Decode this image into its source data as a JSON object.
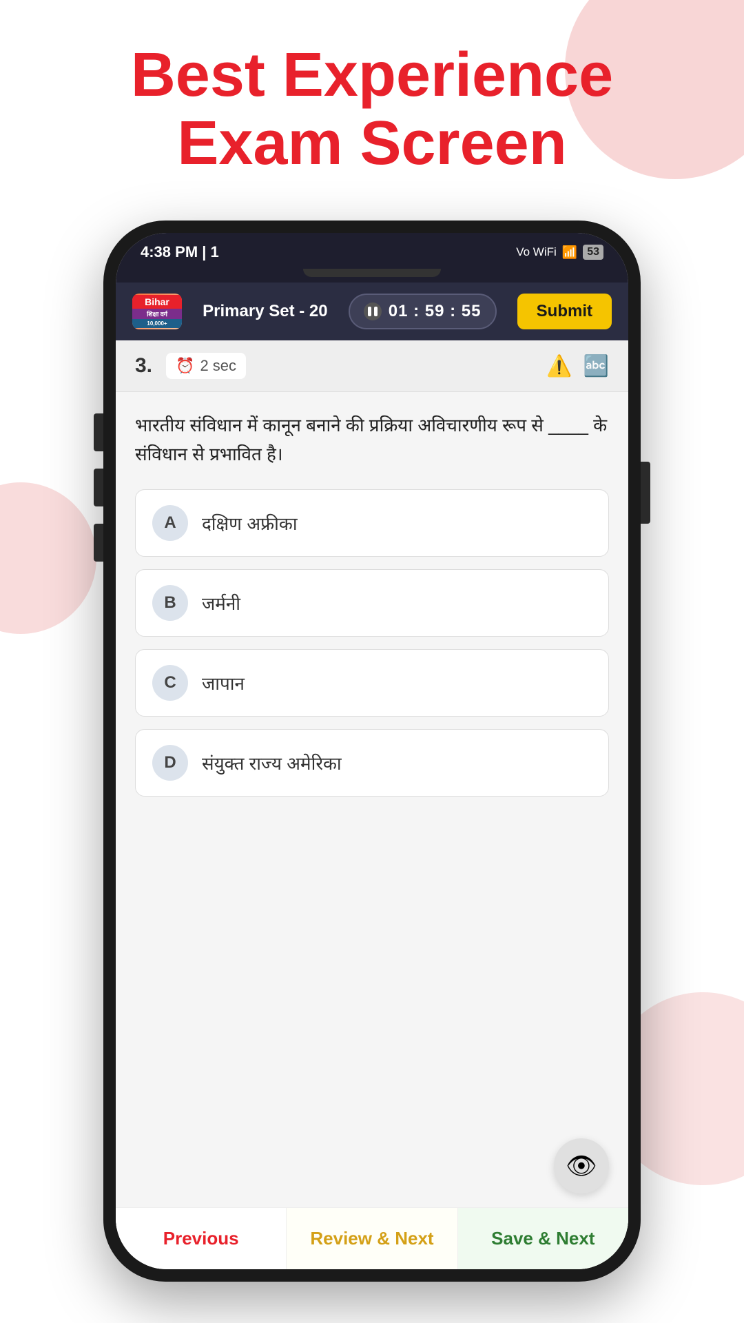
{
  "page": {
    "header": {
      "line1": "Best Experience",
      "line2": "Exam Screen"
    }
  },
  "status_bar": {
    "time": "4:38 PM | 1",
    "wifi_label": "Vo WiFi",
    "battery": "53"
  },
  "app_header": {
    "logo_top": "Bihar",
    "logo_mid": "शिक्षा वर्ग",
    "logo_bot": "10,000+",
    "set_name": "Primary Set - 20",
    "timer": "01 : 59 : 55",
    "submit_label": "Submit"
  },
  "question": {
    "number": "3.",
    "time_label": "2 sec",
    "text": "भारतीय संविधान में कानून बनाने की प्रक्रिया अविचारणीय रूप से ____ के संविधान से प्रभावित है।",
    "options": [
      {
        "label": "A",
        "text": "दक्षिण अफ्रीका"
      },
      {
        "label": "B",
        "text": "जर्मनी"
      },
      {
        "label": "C",
        "text": "जापान"
      },
      {
        "label": "D",
        "text": "संयुक्त राज्य अमेरिका"
      }
    ]
  },
  "bottom_nav": {
    "previous_label": "Previous",
    "review_label": "Review & Next",
    "save_label": "Save & Next"
  },
  "colors": {
    "accent_red": "#e8212b",
    "accent_yellow": "#f5c400",
    "accent_green": "#2e7d32",
    "bg_pink": "#f5c5c5"
  }
}
